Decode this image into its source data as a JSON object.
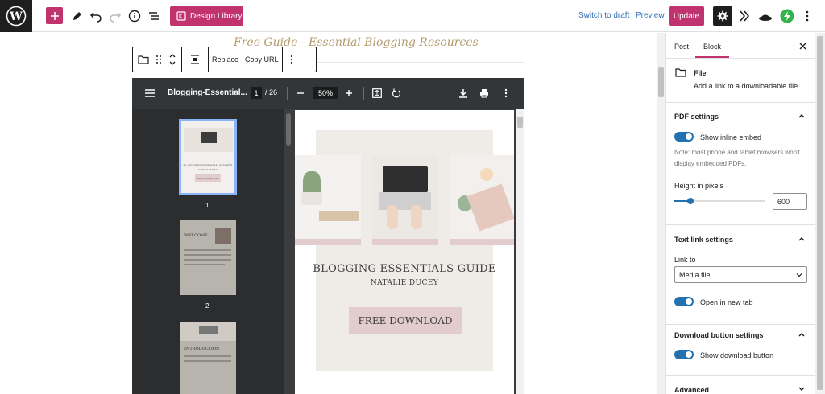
{
  "topbar": {
    "design_library_label": "Design Library",
    "switch_to_draft_label": "Switch to draft",
    "preview_label": "Preview",
    "update_label": "Update",
    "accent_color": "#c0336f"
  },
  "content": {
    "guide_title": "Free Guide - Essential Blogging Resources"
  },
  "block_toolbar": {
    "replace_label": "Replace",
    "copy_url_label": "Copy URL"
  },
  "pdf": {
    "title": "Blogging-Essential...",
    "current_page": "1",
    "page_total": "/ 26",
    "zoom": "50%",
    "thumb_numbers": [
      "1",
      "2"
    ],
    "cover_title": "BLOGGING ESSENTIALS GUIDE",
    "cover_author": "NATALIE DUCEY",
    "cover_button": "FREE DOWNLOAD",
    "thumb1_title": "BLOGGING ESSENTIALS GUIDE",
    "thumb1_sub": "NATALIE DUCEY",
    "thumb1_btn": "FREE DOWNLOAD",
    "thumb2_title": "WELCOME",
    "thumb3_title": "INTRODUCTION"
  },
  "sidebar": {
    "tab_post": "Post",
    "tab_block": "Block",
    "block_name": "File",
    "block_description": "Add a link to a downloadable file.",
    "pdf_settings": {
      "title": "PDF settings",
      "show_inline_embed": "Show inline embed",
      "note": "Note: most phone and tablet browsers won't display embedded PDFs.",
      "height_label": "Height in pixels",
      "height_value": "600",
      "height_fraction": 0.18
    },
    "text_link_settings": {
      "title": "Text link settings",
      "link_to_label": "Link to",
      "link_to_value": "Media file",
      "open_new_tab": "Open in new tab"
    },
    "download_button_settings": {
      "title": "Download button settings",
      "show_download_button": "Show download button"
    },
    "advanced_title": "Advanced"
  }
}
